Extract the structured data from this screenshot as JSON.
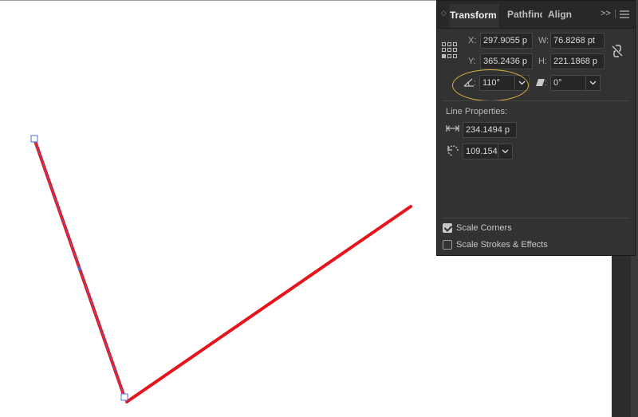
{
  "panel": {
    "tabs": [
      {
        "label": "Transform",
        "active": true
      },
      {
        "label": "Pathfinder",
        "active": false
      },
      {
        "label": "Align",
        "active": false
      }
    ],
    "expand_icon": ">>",
    "menu_icon": "hamburger-menu-icon",
    "grip_icon": "◇"
  },
  "transform": {
    "x_label": "X:",
    "x_value": "297.9055 p",
    "y_label": "Y:",
    "y_value": "365.2436 p",
    "w_label": "W:",
    "w_value": "76.8268 pt",
    "h_label": "H:",
    "h_value": "221.1868 p",
    "angle_label": ":",
    "angle_value": "110°",
    "shear_label": ":",
    "shear_value": "0°"
  },
  "line_properties": {
    "title": "Line Properties:",
    "length_value": "234.1494 p",
    "angle_value": "109.154"
  },
  "options": {
    "scale_corners_label": "Scale Corners",
    "scale_corners_checked": true,
    "scale_strokes_label": "Scale Strokes & Effects",
    "scale_strokes_checked": false
  },
  "artwork": {
    "stroke_color": "#e8141c",
    "selection_color": "#4a6fd6"
  },
  "colors": {
    "panel_bg": "#323232",
    "field_bg": "#262626",
    "highlight": "#d8b040"
  }
}
